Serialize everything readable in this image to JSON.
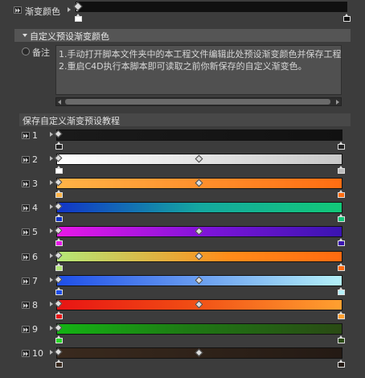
{
  "top_gradient": {
    "label": "渐变颜色",
    "gradient": "linear-gradient(90deg,#ffffff 0%,#101010 1%,#101010 100%)",
    "stop_left_color": "#ffffff",
    "stop_right_color": "#101010"
  },
  "section": {
    "title": "自定义预设渐变颜色",
    "note_label": "备注",
    "note_lines": [
      "1.手动打开脚本文件夹中的本工程文件编辑此处预设渐变颜色并保存工程",
      "2.重启C4D执行本脚本即可读取之前你新保存的自定义渐变色。"
    ],
    "tutorial_header": "保存自定义渐变预设教程"
  },
  "presets": [
    {
      "label": "1",
      "gradient": "linear-gradient(90deg,#1a1a1a,#111111)",
      "left": "#222222",
      "right": "#222222",
      "mid": false
    },
    {
      "label": "2",
      "gradient": "linear-gradient(90deg,#ffffff,#c8c8c8)",
      "left": "#ffffff",
      "right": "#bbbbbb",
      "mid": true
    },
    {
      "label": "3",
      "gradient": "linear-gradient(90deg,#ffb347,#ff6d12)",
      "left": "#ffb347",
      "right": "#ff6d12",
      "mid": true
    },
    {
      "label": "4",
      "gradient": "linear-gradient(90deg,#1234c8,#14a8a0 50%,#12c878)",
      "left": "#1234c8",
      "right": "#12c878",
      "mid": false
    },
    {
      "label": "5",
      "gradient": "linear-gradient(90deg,#e818e8,#7a14d8 55%,#3a14b0)",
      "left": "#e818e8",
      "right": "#3a14b0",
      "mid": true
    },
    {
      "label": "6",
      "gradient": "linear-gradient(90deg,#b4e878,#ff8c1a 60%,#ff6a10)",
      "left": "#b4e878",
      "right": "#ff6a10",
      "mid": true
    },
    {
      "label": "7",
      "gradient": "linear-gradient(90deg,#1e4ee8,#6a9ef0 50%,#b4f0f8)",
      "left": "#1e4ee8",
      "right": "#b4f0f8",
      "mid": true
    },
    {
      "label": "8",
      "gradient": "linear-gradient(90deg,#e81414,#f04a14 45%,#ffa030)",
      "left": "#e81414",
      "right": "#ffa030",
      "mid": true
    },
    {
      "label": "9",
      "gradient": "linear-gradient(90deg,#14b414,#1e7a14 45%,#2a4a14)",
      "left": "#28d828",
      "right": "#2a4a14",
      "mid": false
    },
    {
      "label": "10",
      "gradient": "linear-gradient(90deg,#3a2a1e,#241a14)",
      "left": "#3a2a1e",
      "right": "#241a14",
      "mid": true
    }
  ]
}
